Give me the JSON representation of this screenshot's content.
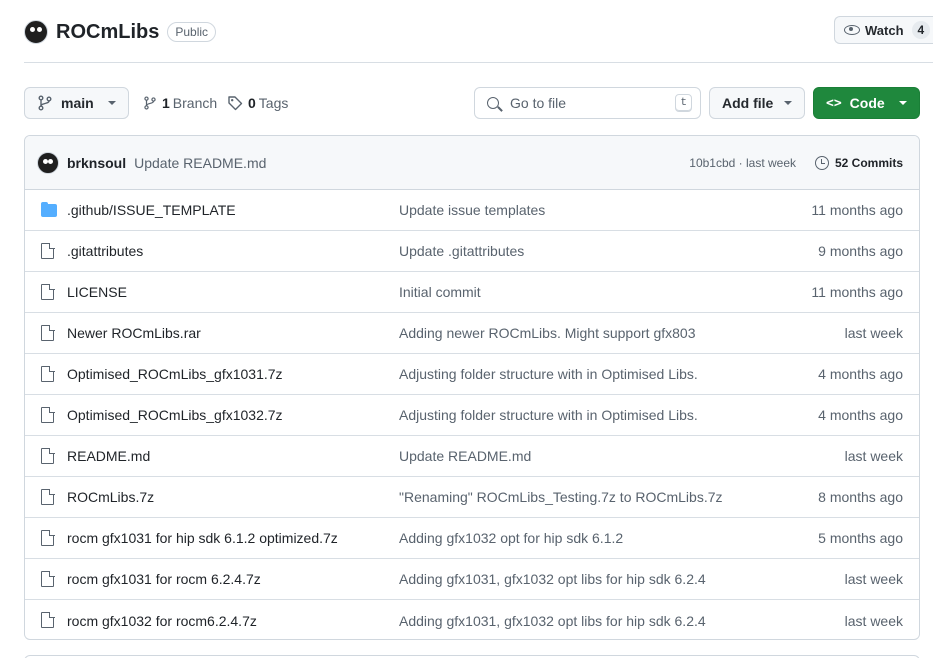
{
  "repo": {
    "name": "ROCmLibs",
    "visibility": "Public",
    "watch_label": "Watch",
    "watch_count": "4"
  },
  "toolbar": {
    "branch": "main",
    "branches_count": "1",
    "branches_label": "Branch",
    "tags_count": "0",
    "tags_label": "Tags",
    "search_placeholder": "Go to file",
    "search_shortcut": "t",
    "add_file_label": "Add file",
    "code_label": "Code"
  },
  "latest_commit": {
    "author": "brknsoul",
    "message": "Update README.md",
    "hash_time": "10b1cbd · last week",
    "commits_label": "52 Commits"
  },
  "files": [
    {
      "type": "folder",
      "name": ".github/ISSUE_TEMPLATE",
      "message": "Update issue templates",
      "time": "11 months ago"
    },
    {
      "type": "file",
      "name": ".gitattributes",
      "message": "Update .gitattributes",
      "time": "9 months ago"
    },
    {
      "type": "file",
      "name": "LICENSE",
      "message": "Initial commit",
      "time": "11 months ago"
    },
    {
      "type": "file",
      "name": "Newer ROCmLibs.rar",
      "message": "Adding newer ROCmLibs. Might support gfx803",
      "time": "last week"
    },
    {
      "type": "file",
      "name": "Optimised_ROCmLibs_gfx1031.7z",
      "message": "Adjusting folder structure with in Optimised Libs.",
      "time": "4 months ago"
    },
    {
      "type": "file",
      "name": "Optimised_ROCmLibs_gfx1032.7z",
      "message": "Adjusting folder structure with in Optimised Libs.",
      "time": "4 months ago"
    },
    {
      "type": "file",
      "name": "README.md",
      "message": "Update README.md",
      "time": "last week"
    },
    {
      "type": "file",
      "name": "ROCmLibs.7z",
      "message": "\"Renaming\" ROCmLibs_Testing.7z to ROCmLibs.7z",
      "time": "8 months ago"
    },
    {
      "type": "file",
      "name": "rocm gfx1031 for hip sdk 6.1.2 optimized.7z",
      "message": "Adding gfx1032 opt for hip sdk 6.1.2",
      "time": "5 months ago"
    },
    {
      "type": "file",
      "name": "rocm gfx1031 for rocm 6.2.4.7z",
      "message": "Adding gfx1031, gfx1032 opt libs for hip sdk 6.2.4",
      "time": "last week"
    },
    {
      "type": "file",
      "name": "rocm gfx1032 for rocm6.2.4.7z",
      "message": "Adding gfx1031, gfx1032 opt libs for hip sdk 6.2.4",
      "time": "last week"
    }
  ],
  "colors": {
    "accent_green": "#1f883d",
    "folder_blue": "#54aeff",
    "muted_text": "#59636e"
  },
  "icons": {
    "owner": "owner-avatar",
    "watch": "eye-icon",
    "branch": "git-branch-icon",
    "tag": "tag-icon",
    "search": "search-icon",
    "code": "code-icon",
    "history": "clock-history-icon",
    "folder": "folder-icon",
    "file": "file-icon"
  }
}
